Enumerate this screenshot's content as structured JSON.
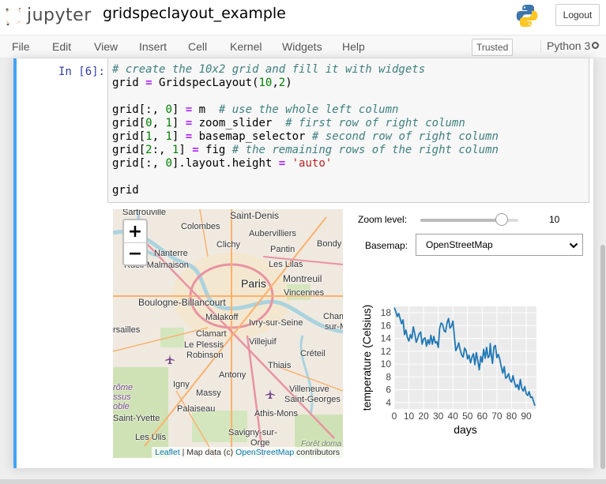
{
  "header": {
    "app_name": "jupyter",
    "notebook_name": "gridspeclayout_example",
    "logout_label": "Logout"
  },
  "menubar": {
    "items": [
      "File",
      "Edit",
      "View",
      "Insert",
      "Cell",
      "Kernel",
      "Widgets",
      "Help"
    ],
    "trusted_label": "Trusted",
    "kernel_name": "Python 3"
  },
  "cell": {
    "prompt": "In [6]:",
    "code_lines": [
      "# create the 10x2 grid and fill it with widgets",
      "grid = GridspecLayout(10,2)",
      "",
      "grid[:, 0] = m  # use the whole left column",
      "grid[0, 1] = zoom_slider  # first row of right column",
      "grid[1, 1] = basemap_selector # second row of right column",
      "grid[2:, 1] = fig # the remaining rows of the right column",
      "grid[:, 0].layout.height = 'auto'",
      "",
      "grid"
    ]
  },
  "map": {
    "zoom_in": "+",
    "zoom_out": "−",
    "attribution": {
      "leaflet": "Leaflet",
      "middle": " | Map data (c) ",
      "osm": "OpenStreetMap",
      "suffix": " contributors"
    },
    "places": [
      "Sartrouville",
      "Saint-Denis",
      "Colombes",
      "Aubervilliers",
      "Bondy",
      "Clichy",
      "Pantin",
      "Nanterre",
      "Rueil-Malmaison",
      "Les Lilas",
      "Paris",
      "Montreuil",
      "Vincennes",
      "Boulogne-Billancourt",
      "Malakoff",
      "Ivry-sur-Seine",
      "Cham",
      "sur-M",
      "rsailles",
      "Clamart",
      "Villejuif",
      "Le Plessis",
      "Robinson",
      "Créteil",
      "Thiais",
      "Antony",
      "Igny",
      "Massy",
      "Villeneuve",
      "Saint-Georges",
      "Palaiseau",
      "Athis-Mons",
      "Saint-Yvette",
      "Savigny-sur-",
      "Orge",
      "Les Ulis",
      "rôme",
      "ssus",
      "oble",
      "Forêt doma"
    ]
  },
  "controls": {
    "zoom_label": "Zoom level:",
    "zoom_value": 10,
    "zoom_min": 0,
    "zoom_max": 12,
    "basemap_label": "Basemap:",
    "basemap_value": "OpenStreetMap"
  },
  "chart_data": {
    "type": "line",
    "xlabel": "days",
    "ylabel": "temperature (Celsius)",
    "xticks": [
      0,
      10,
      20,
      30,
      40,
      50,
      60,
      70,
      80,
      90
    ],
    "yticks": [
      4,
      6,
      8,
      10,
      12,
      14,
      16,
      18
    ],
    "xlim": [
      0,
      97
    ],
    "ylim": [
      3,
      19
    ],
    "grid": true,
    "color": "#1f77b4",
    "x": [
      0,
      1,
      2,
      3,
      4,
      5,
      6,
      7,
      8,
      9,
      10,
      11,
      12,
      13,
      14,
      15,
      16,
      17,
      18,
      19,
      20,
      21,
      22,
      23,
      24,
      25,
      26,
      27,
      28,
      29,
      30,
      31,
      32,
      33,
      34,
      35,
      36,
      37,
      38,
      39,
      40,
      41,
      42,
      43,
      44,
      45,
      46,
      47,
      48,
      49,
      50,
      51,
      52,
      53,
      54,
      55,
      56,
      57,
      58,
      59,
      60,
      61,
      62,
      63,
      64,
      65,
      65.5,
      66,
      67,
      68,
      69,
      70,
      71,
      72,
      73,
      74,
      75,
      76,
      77,
      78,
      79,
      80,
      81,
      82,
      83,
      84,
      85,
      86,
      87,
      88,
      89,
      90,
      91,
      92,
      93,
      94,
      95,
      96
    ],
    "y": [
      18.8,
      18.2,
      17.4,
      17.9,
      17.1,
      16.3,
      16.9,
      14.6,
      15.3,
      14.1,
      13.6,
      14.6,
      14.0,
      15.8,
      14.7,
      13.4,
      14.0,
      14.7,
      15.0,
      13.1,
      13.9,
      14.1,
      12.8,
      13.8,
      13.1,
      14.5,
      13.1,
      14.3,
      13.3,
      13.5,
      12.6,
      15.6,
      16.4,
      16.2,
      15.2,
      15.0,
      16.4,
      17.1,
      15.6,
      15.9,
      16.7,
      14.3,
      12.1,
      12.6,
      13.3,
      12.2,
      11.4,
      11.1,
      12.5,
      12.1,
      10.8,
      11.4,
      10.2,
      11.1,
      11.6,
      9.9,
      11.8,
      10.5,
      9.1,
      11.2,
      10.3,
      12.3,
      10.9,
      12.6,
      11.0,
      11.3,
      13.2,
      11.8,
      10.1,
      12.7,
      12.9,
      11.0,
      11.5,
      10.7,
      9.6,
      8.6,
      9.6,
      7.8,
      8.0,
      8.5,
      7.5,
      7.2,
      8.2,
      7.1,
      6.4,
      6.8,
      6.0,
      7.6,
      6.2,
      5.8,
      6.5,
      5.4,
      5.1,
      5.7,
      4.8,
      4.9,
      4.2,
      3.5
    ]
  }
}
